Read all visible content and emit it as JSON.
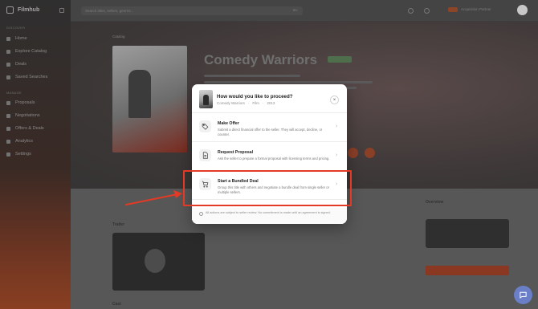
{
  "app": {
    "logo_text": "Filmhub",
    "sidebar_sections": [
      "Discover",
      "Manage"
    ],
    "sidebar_items": [
      "Home",
      "Explore Catalog",
      "Deals",
      "Saved Searches",
      "Proposals",
      "Negotiations",
      "Offers & Deals",
      "Analytics",
      "Settings"
    ]
  },
  "topbar": {
    "search_placeholder": "Search titles, sellers, genres...",
    "search_shortcut": "⌘K",
    "user_label": "Acquisition Partner"
  },
  "hero": {
    "breadcrumb": "Catalog",
    "title": "Comedy Warriors"
  },
  "lower": {
    "section_left": "Trailer",
    "section_left_2": "Cast",
    "section_right": "Overview"
  },
  "modal": {
    "title": "How would you like to proceed?",
    "subtitle_parts": [
      "Comedy Warriors",
      "·",
      "Film",
      "·",
      "2013"
    ],
    "close_glyph": "×",
    "options": [
      {
        "title": "Make Offer",
        "description": "Submit a direct financial offer to the seller. They will accept, decline, or counter.",
        "icon": "tag-icon"
      },
      {
        "title": "Request Proposal",
        "description": "Ask the seller to prepare a formal proposal with licensing terms and pricing.",
        "icon": "document-icon"
      },
      {
        "title": "Start a Bundled Deal",
        "description": "Group this title with others and negotiate a bundle deal from single seller or multiple sellers.",
        "icon": "cart-icon"
      }
    ],
    "chevron_glyph": "›",
    "footer_note": "All actions are subject to seller review. No commitment is made until an agreement is signed."
  },
  "colors": {
    "highlight": "#e23a25",
    "modal_bg": "#ffffff",
    "chat_fab": "#6b7fc9"
  }
}
